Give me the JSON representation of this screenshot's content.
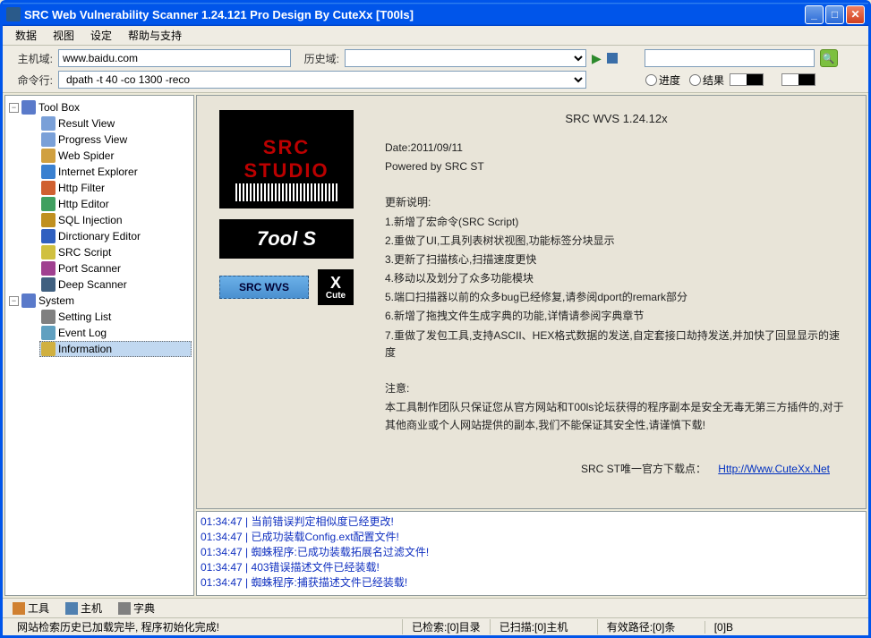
{
  "title": "SRC Web Vulnerability Scanner 1.24.121 Pro Design By CuteXx [T00ls]",
  "menu": [
    "数据",
    "视图",
    "设定",
    "帮助与支持"
  ],
  "toolbar": {
    "host_label": "主机域:",
    "host_value": "www.baidu.com",
    "history_label": "历史域:",
    "cmd_label": "命令行:",
    "cmd_value": "dpath -t 40 -co 1300 -reco",
    "radio_progress": "进度",
    "radio_result": "结果"
  },
  "tree": {
    "root1": "Tool Box",
    "items1": [
      "Result View",
      "Progress View",
      "Web Spider",
      "Internet Explorer",
      "Http Filter",
      "Http Editor",
      "SQL Injection",
      "Dirctionary Editor",
      "SRC Script",
      "Port Scanner",
      "Deep Scanner"
    ],
    "root2": "System",
    "items2": [
      "Setting List",
      "Event Log",
      "Information"
    ]
  },
  "info": {
    "title": "SRC WVS 1.24.12x",
    "date": "Date:2011/09/11",
    "powered": "Powered by SRC ST",
    "update_header": "更新说明:",
    "updates": [
      "1.新增了宏命令(SRC Script)",
      "2.重做了UI,工具列表树状视图,功能标签分块显示",
      "3.更新了扫描核心,扫描速度更快",
      "4.移动以及划分了众多功能模块",
      "5.端口扫描器以前的众多bug已经修复,请参阅dport的remark部分",
      "6.新增了拖拽文件生成字典的功能,详情请参阅字典章节",
      "7.重做了发包工具,支持ASCII、HEX格式数据的发送,自定套接口劫持发送,并加快了回显显示的速度"
    ],
    "notice_header": "注意:",
    "notice": "本工具制作团队只保证您从官方网站和T00ls论坛获得的程序副本是安全无毒无第三方插件的,对于其他商业或个人网站提供的副本,我们不能保证其安全性,请谨慎下载!",
    "download_label": "SRC ST唯一官方下载点：",
    "download_url": "Http://Www.CuteXx.Net",
    "logo_src_l1": "SRC",
    "logo_src_l2": "STUDIO",
    "logo_tools": "7ool S",
    "logo_wvs": "SRC WVS",
    "logo_x": "X",
    "logo_cute": "Cute"
  },
  "log": [
    {
      "ts": "01:34:47",
      "msg": "当前错误判定相似度已经更改!"
    },
    {
      "ts": "01:34:47",
      "msg": "已成功装载Config.ext配置文件!"
    },
    {
      "ts": "01:34:47",
      "msg": "蜘蛛程序:已成功装载拓展名过滤文件!"
    },
    {
      "ts": "01:34:47",
      "msg": "403错误描述文件已经装载!"
    },
    {
      "ts": "01:34:47",
      "msg": "蜘蛛程序:捕获描述文件已经装载!"
    }
  ],
  "bottom_nav": {
    "tools": "工具",
    "host": "主机",
    "dict": "字典"
  },
  "status": {
    "left": "网站检索历史已加载完毕, 程序初始化完成!",
    "searched": "已检索:[0]目录",
    "scanned": "已扫描:[0]主机",
    "paths": "有效路径:[0]条",
    "bytes": "[0]B"
  }
}
